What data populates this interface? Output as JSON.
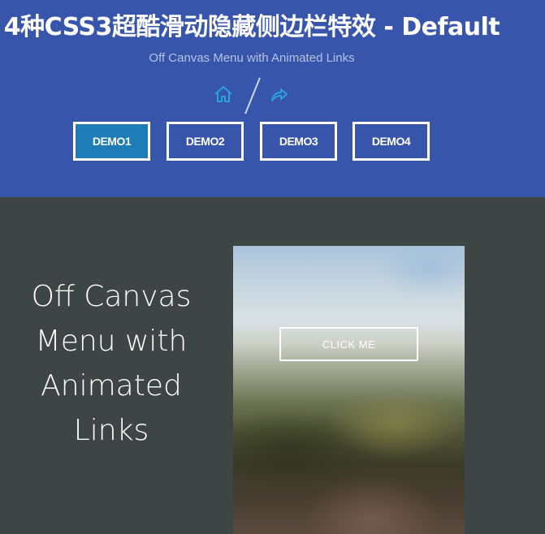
{
  "header": {
    "title": "4种CSS3超酷滑动隐藏侧边栏特效 - Default",
    "subtitle": "Off Canvas Menu with Animated Links",
    "icons": {
      "home": "home-icon",
      "share": "share-icon"
    },
    "colors": {
      "background": "#3855ac",
      "active_button": "#1e7cb6",
      "icon": "#29a3e0"
    },
    "demos": [
      {
        "label": "DEMO1",
        "active": true
      },
      {
        "label": "DEMO2",
        "active": false
      },
      {
        "label": "DEMO3",
        "active": false
      },
      {
        "label": "DEMO4",
        "active": false
      }
    ]
  },
  "main": {
    "heading_lines": [
      "Off Canvas",
      "Menu with",
      "Animated",
      "Links"
    ],
    "preview": {
      "button_label": "CLICK ME"
    },
    "colors": {
      "background": "#3e4545"
    }
  }
}
